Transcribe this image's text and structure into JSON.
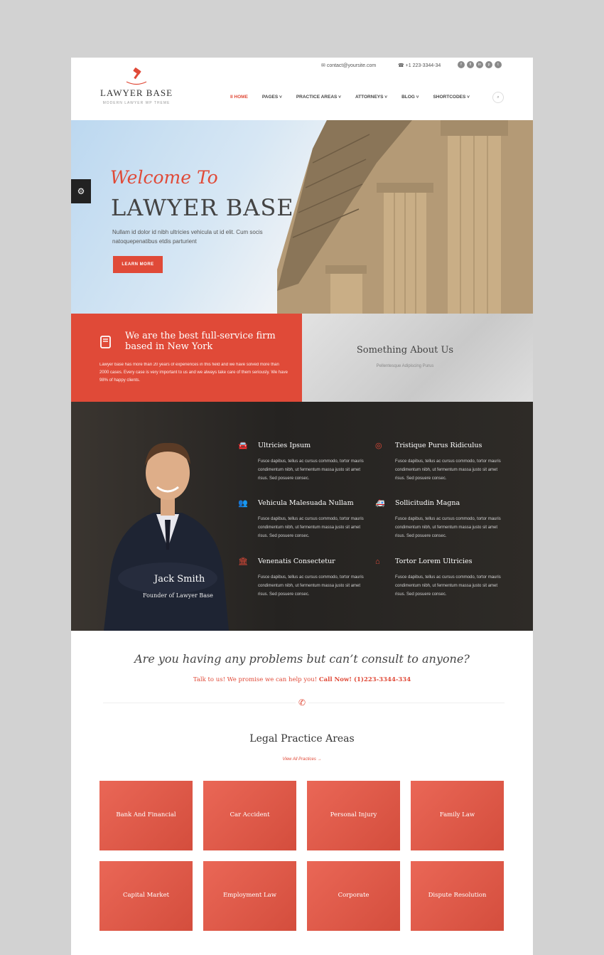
{
  "topbar": {
    "email": "contact@yoursite.com",
    "phone": "+1 223-3344-34",
    "social": [
      "f",
      "fl",
      "in",
      "p",
      "t"
    ]
  },
  "logo": {
    "name": "LAWYER BASE",
    "tagline": "MODERN LAWYER WP THEME"
  },
  "nav": {
    "items": [
      "II HOME",
      "PAGES ˅",
      "PRACTICE AREAS ˅",
      "ATTORNEYS ˅",
      "BLOG ˅",
      "SHORTCODES ˅"
    ],
    "active_color": "#e04a38",
    "search_icon": "search-icon"
  },
  "hero": {
    "welcome": "Welcome To",
    "title": "LAWYER BASE",
    "text": "Nullam id dolor id nibh ultricies vehicula ut id elit. Cum socis natoquepenatibus etdis parturient",
    "button": "LEARN MORE"
  },
  "intro": {
    "title": "We are the best full-service firm based in New York",
    "text": "Lawyer base has more than 20 years of experiences in this field and we have solved more than 2000 cases. Every case is very important to us and we always take care of them seriously. We have 98% of happy clients."
  },
  "about": {
    "title": "Something About Us",
    "subtitle": "Pellentesque Adipiscing Purus"
  },
  "founder": {
    "name": "Jack Smith",
    "role": "Founder of Lawyer Base"
  },
  "services": [
    {
      "title": "Ultricies Ipsum",
      "icon": "car-icon",
      "text": "Fusce dapibus, tellus ac cursus commodo, tortor mauris condimentum nibh, ut fermentum massa justo sit amet risus. Sed posuere consec."
    },
    {
      "title": "Tristique Purus Ridiculus",
      "icon": "lifebuoy-icon",
      "text": "Fusce dapibus, tellus ac cursus commodo, tortor mauris condimentum nibh, ut fermentum massa justo sit amet risus. Sed posuere consec."
    },
    {
      "title": "Vehicula Malesuada Nullam",
      "icon": "users-icon",
      "text": "Fusce dapibus, tellus ac cursus commodo, tortor mauris condimentum nibh, ut fermentum massa justo sit amet risus. Sed posuere consec."
    },
    {
      "title": "Sollicitudin Magna",
      "icon": "ambulance-icon",
      "text": "Fusce dapibus, tellus ac cursus commodo, tortor mauris condimentum nibh, ut fermentum massa justo sit amet risus. Sed posuere consec."
    },
    {
      "title": "Venenatis Consectetur",
      "icon": "bank-icon",
      "text": "Fusce dapibus, tellus ac cursus commodo, tortor mauris condimentum nibh, ut fermentum massa justo sit amet risus. Sed posuere consec."
    },
    {
      "title": "Tortor Lorem Ultricies",
      "icon": "home-icon",
      "text": "Fusce dapibus, tellus ac cursus commodo, tortor mauris condimentum nibh, ut fermentum massa justo sit amet risus. Sed posuere consec."
    }
  ],
  "cta": {
    "title": "Are you having any problems but can’t consult to anyone?",
    "text": "Talk to us! We promise we can help you!",
    "call": "Call Now! (1)223-3344-334"
  },
  "practice": {
    "title": "Legal Practice Areas",
    "view_all": "View All Practices",
    "areas": [
      "Bank And Financial",
      "Car Accident",
      "Personal Injury",
      "Family Law",
      "Capital Market",
      "Employment Law",
      "Corporate",
      "Dispute Resolution"
    ]
  },
  "colors": {
    "accent": "#e04a38",
    "dark": "#252321"
  }
}
